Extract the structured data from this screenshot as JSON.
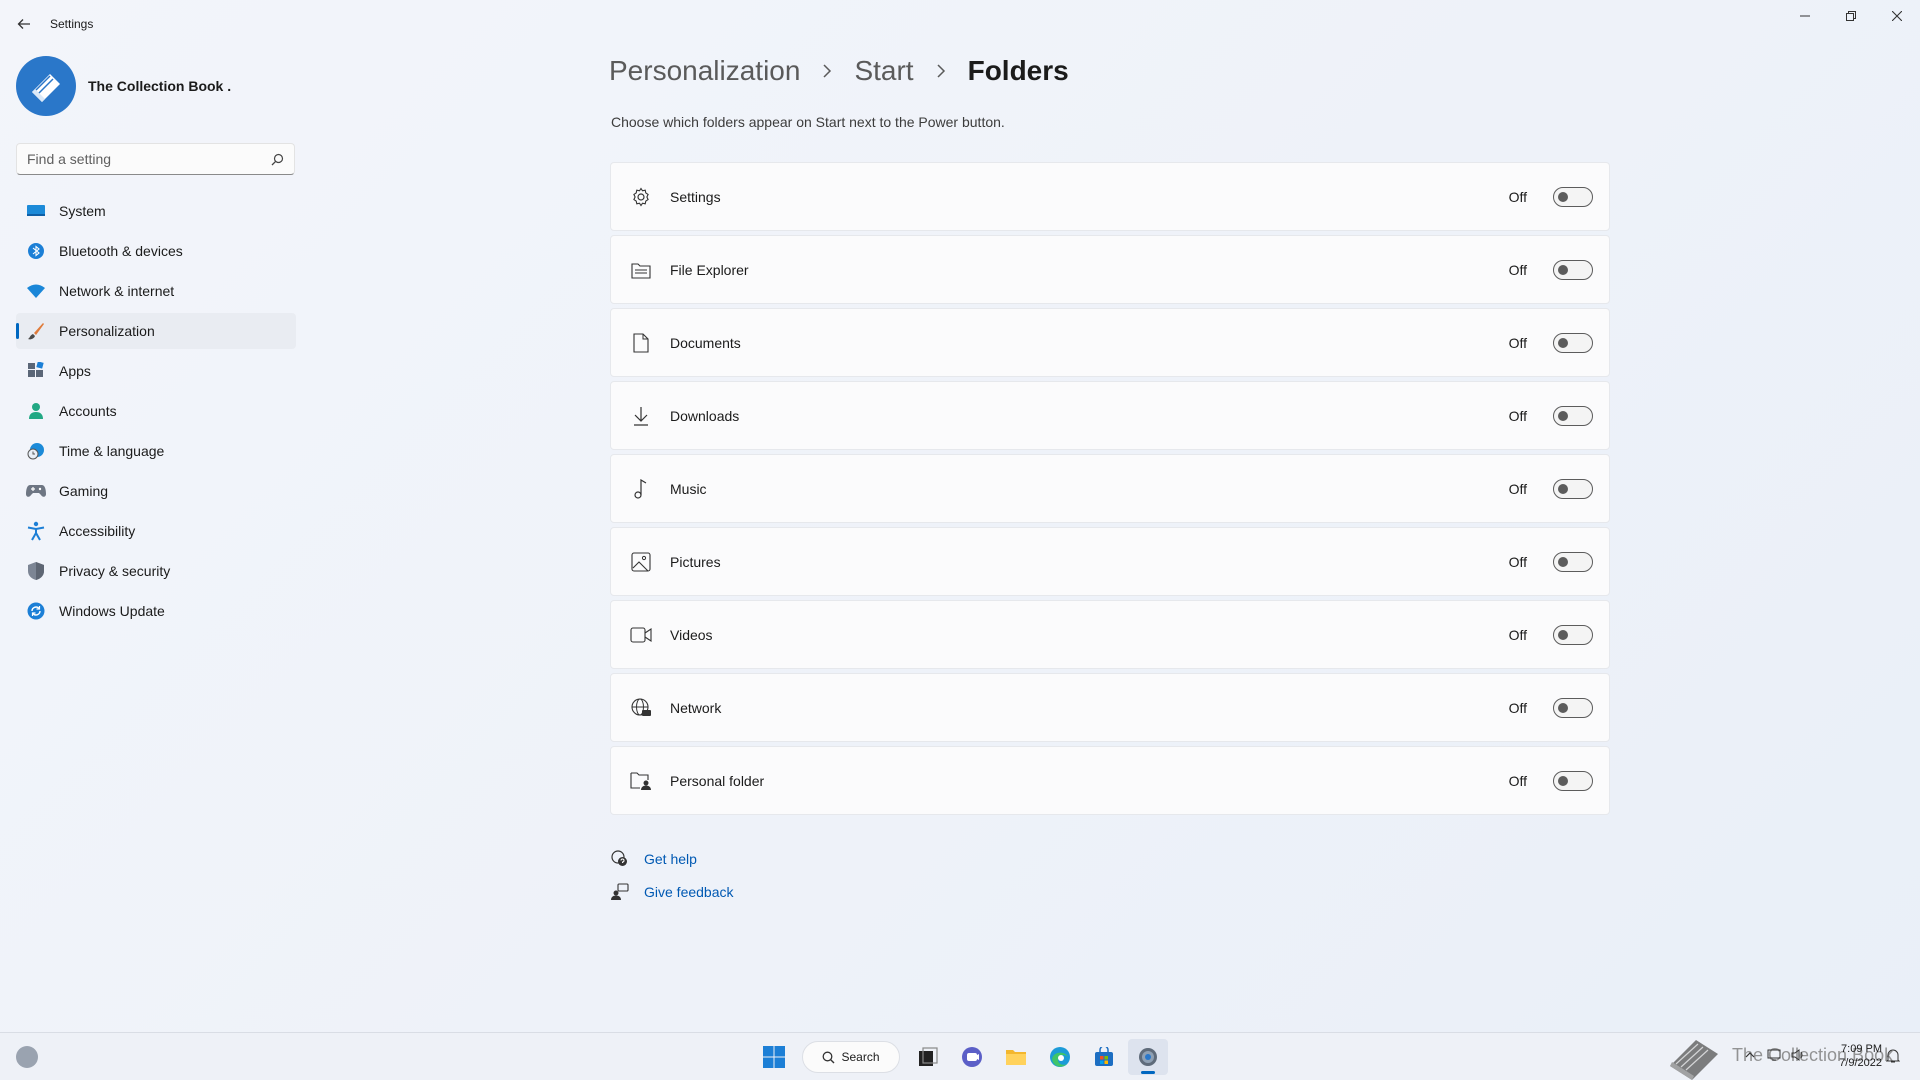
{
  "window": {
    "app_title": "Settings",
    "controls": {
      "minimize": "minimize",
      "restore": "restore",
      "close": "close"
    }
  },
  "profile": {
    "name": "The Collection Book ."
  },
  "search": {
    "placeholder": "Find a setting"
  },
  "sidebar": {
    "items": [
      {
        "label": "System",
        "icon": "monitor-icon"
      },
      {
        "label": "Bluetooth & devices",
        "icon": "bluetooth-icon"
      },
      {
        "label": "Network & internet",
        "icon": "wifi-icon"
      },
      {
        "label": "Personalization",
        "icon": "brush-icon",
        "selected": true
      },
      {
        "label": "Apps",
        "icon": "apps-icon"
      },
      {
        "label": "Accounts",
        "icon": "person-icon"
      },
      {
        "label": "Time & language",
        "icon": "globe-clock-icon"
      },
      {
        "label": "Gaming",
        "icon": "gamepad-icon"
      },
      {
        "label": "Accessibility",
        "icon": "accessibility-icon"
      },
      {
        "label": "Privacy & security",
        "icon": "shield-icon"
      },
      {
        "label": "Windows Update",
        "icon": "update-icon"
      }
    ]
  },
  "breadcrumb": {
    "part1": "Personalization",
    "part2": "Start",
    "current": "Folders"
  },
  "description": "Choose which folders appear on Start next to the Power button.",
  "folders": [
    {
      "label": "Settings",
      "state": "Off",
      "on": false,
      "icon": "gear-icon"
    },
    {
      "label": "File Explorer",
      "state": "Off",
      "on": false,
      "icon": "file-explorer-icon"
    },
    {
      "label": "Documents",
      "state": "Off",
      "on": false,
      "icon": "document-icon"
    },
    {
      "label": "Downloads",
      "state": "Off",
      "on": false,
      "icon": "download-icon"
    },
    {
      "label": "Music",
      "state": "Off",
      "on": false,
      "icon": "music-note-icon"
    },
    {
      "label": "Pictures",
      "state": "Off",
      "on": false,
      "icon": "picture-icon"
    },
    {
      "label": "Videos",
      "state": "Off",
      "on": false,
      "icon": "video-camera-icon"
    },
    {
      "label": "Network",
      "state": "Off",
      "on": false,
      "icon": "network-globe-icon"
    },
    {
      "label": "Personal folder",
      "state": "Off",
      "on": false,
      "icon": "personal-folder-icon"
    }
  ],
  "help": {
    "get_help": "Get help",
    "give_feedback": "Give feedback"
  },
  "taskbar": {
    "search_label": "Search",
    "watermark": "The Collection Book",
    "time": "7:09 PM",
    "date": "7/9/2022"
  },
  "colors": {
    "accent": "#0067c0",
    "link": "#0059b3",
    "background": "#f3f5fa"
  }
}
